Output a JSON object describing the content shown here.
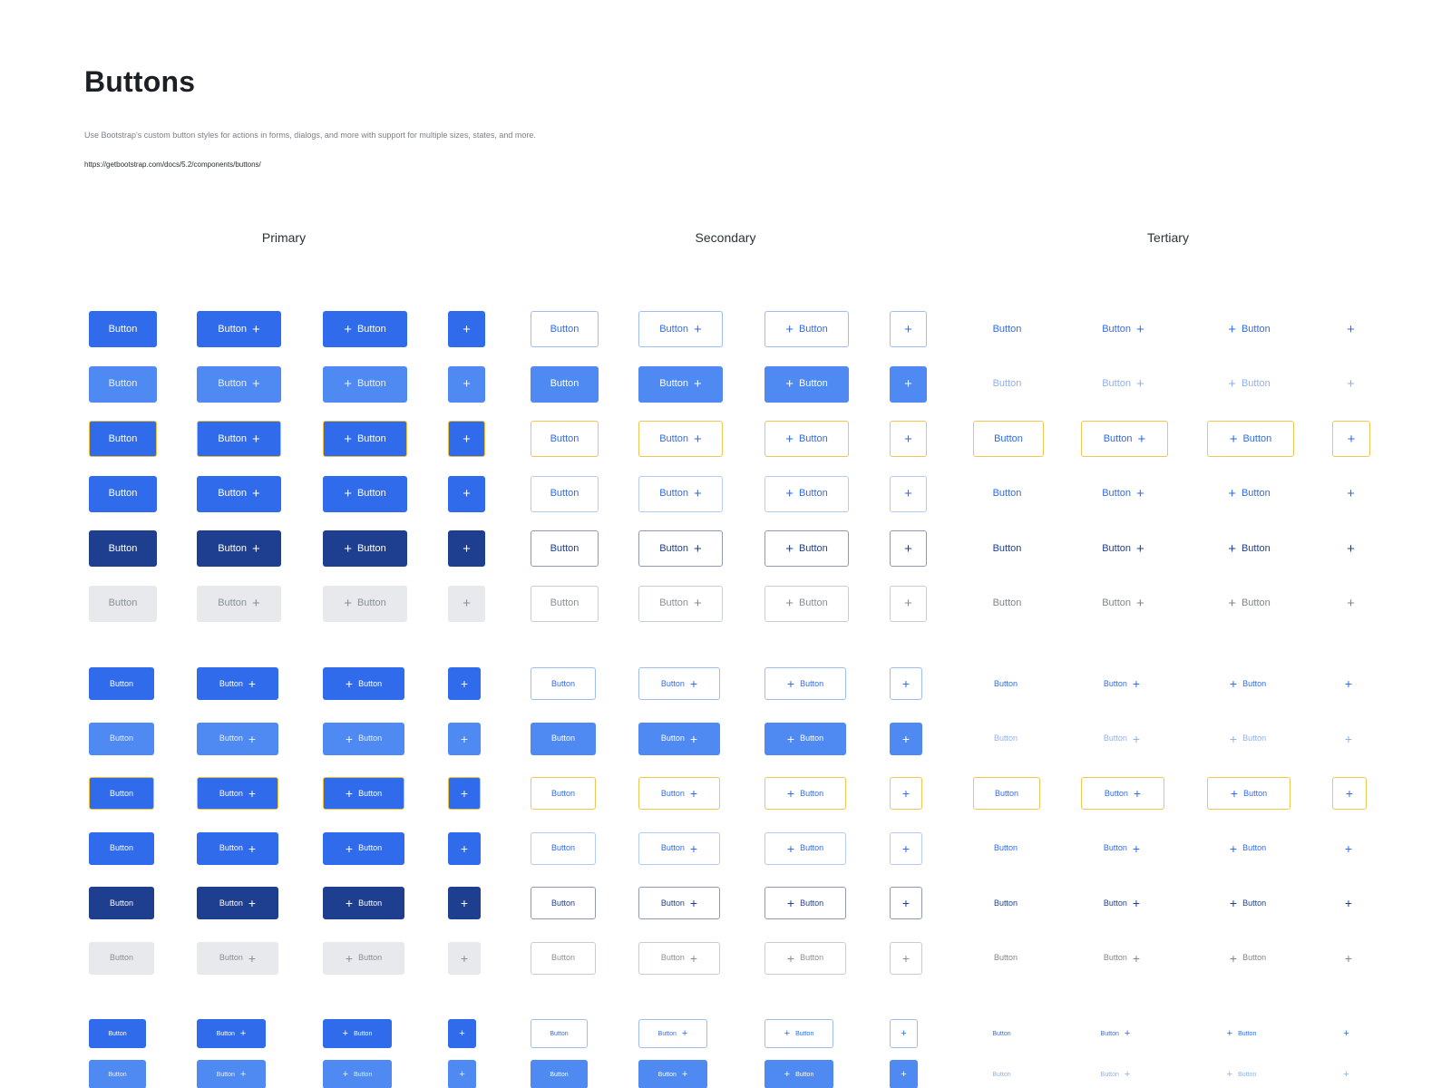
{
  "header": {
    "title": "Buttons",
    "description": "Use Bootstrap's custom button styles for actions in forms, dialogs, and more with support for multiple sizes, states, and more.",
    "url": "https://getbootstrap.com/docs/5.2/components/buttons/"
  },
  "columns": [
    {
      "key": "primary",
      "label": "Primary"
    },
    {
      "key": "secondary",
      "label": "Secondary"
    },
    {
      "key": "tertiary",
      "label": "Tertiary"
    }
  ],
  "button": {
    "label": "Button",
    "icon": "plus-icon",
    "icon_glyph": "+"
  },
  "variants": [
    "text-only",
    "text-with-trailing-icon",
    "text-with-leading-icon",
    "icon-only"
  ],
  "states": [
    "default",
    "hover",
    "focus",
    "active",
    "pressed",
    "disabled"
  ],
  "sizes": [
    "medium",
    "small",
    "extra-small"
  ],
  "colors": {
    "primary": "#2f6bea",
    "primary_hover": "#4f8af2",
    "primary_pressed": "#1e3f8f",
    "focus_ring": "#f0bf3c",
    "disabled_bg": "#e7e9ec",
    "disabled_text": "#8a8f96",
    "secondary_border": "#9fbdf3"
  }
}
